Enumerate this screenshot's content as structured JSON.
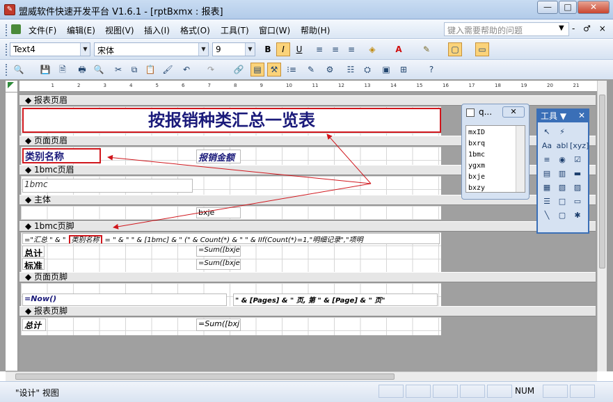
{
  "window": {
    "title": "盟威软件快速开发平台 V1.6.1 - [rptBxmx : 报表]",
    "min_label": "—",
    "max_label": "□",
    "close_label": "✕"
  },
  "menu": {
    "items": [
      "文件(F)",
      "编辑(E)",
      "视图(V)",
      "插入(I)",
      "格式(O)",
      "工具(T)",
      "窗口(W)",
      "帮助(H)"
    ],
    "help_placeholder": "键入需要帮助的问题",
    "mdi_controls": "- ♂ ×"
  },
  "format_toolbar": {
    "object": "Text4",
    "font": "宋体",
    "size": "9",
    "bold": "B",
    "italic": "I",
    "underline": "U"
  },
  "report": {
    "bands": {
      "report_header": "报表页眉",
      "page_header": "页面页眉",
      "group_header": "1bmc页眉",
      "detail": "主体",
      "group_footer": "1bmc页脚",
      "page_footer": "页面页脚",
      "report_footer": "报表页脚"
    },
    "title": "按报销种类汇总一览表",
    "category_label": "类别名称",
    "amount_label": "报销金额",
    "group_field": "1bmc",
    "detail_field": "bxje",
    "group_footer_expr_1": "=\"汇总 \" & \"",
    "group_footer_expr_label": "类别名称",
    "group_footer_expr_2": "= \" & \" \" & [1bmc] & \" (\" & Count(*) & \" \" & IIf(Count(*)=1,\"明细记录\",\"项明",
    "subtotal_label": "总计",
    "subtotal_expr": "=Sum([bxje",
    "standard_label": "标准",
    "standard_expr": "=Sum([bxje",
    "now_expr": "=Now()",
    "pages_expr": "\" & [Pages] & \" 页, 第 \" & [Page] & \" 页\"",
    "total_label": "总计",
    "total_expr": "=Sum([bxj"
  },
  "field_list": {
    "title": "q...",
    "close": "✕",
    "fields": [
      "mxID",
      "bxrq",
      "1bmc",
      "ygxm",
      "bxje",
      "bxzy"
    ]
  },
  "toolbox": {
    "title": "工具",
    "close": "✕",
    "tools": [
      "↖",
      "⚡",
      "Aa",
      "abl",
      "[xyz]",
      "≡",
      "◉",
      "☑",
      "▤",
      "▥",
      "▬",
      "▦",
      "▧",
      "▨",
      "☰",
      "□",
      "▭",
      "╲",
      "▢",
      "✱"
    ]
  },
  "status": {
    "mode": "\"设计\" 视图",
    "num": "NUM"
  },
  "ruler": {
    "marks": [
      "1",
      "2",
      "3",
      "4",
      "5",
      "6",
      "7",
      "8",
      "9",
      "10",
      "11",
      "12",
      "13",
      "14",
      "15",
      "16",
      "17",
      "18",
      "19",
      "20",
      "21"
    ]
  }
}
